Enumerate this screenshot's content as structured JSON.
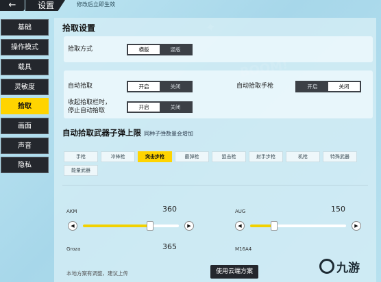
{
  "header": {
    "back_icon": "←",
    "title": "设置",
    "hint": "修改后立即生效"
  },
  "sidebar": {
    "items": [
      {
        "label": "基础"
      },
      {
        "label": "操作模式"
      },
      {
        "label": "载具"
      },
      {
        "label": "灵敏度"
      },
      {
        "label": "拾取",
        "active": true
      },
      {
        "label": "画面"
      },
      {
        "label": "声音"
      },
      {
        "label": "隐私"
      }
    ]
  },
  "pickup": {
    "section_title": "拾取设置",
    "mode": {
      "label": "拾取方式",
      "options": [
        "横版",
        "竖版"
      ],
      "selected": "横版"
    },
    "auto": {
      "label": "自动拾取",
      "options": [
        "开启",
        "关闭"
      ],
      "selected": "开启"
    },
    "auto_pistol": {
      "label": "自动拾取手枪",
      "options": [
        "开启",
        "关闭"
      ],
      "selected": "关闭"
    },
    "collapse": {
      "label_line1": "收起拾取栏时，",
      "label_line2": "停止自动拾取",
      "options": [
        "开启",
        "关闭"
      ],
      "selected": "开启"
    }
  },
  "limits": {
    "section_title": "自动拾取武器子弹上限",
    "sub": "同种子弹数量会增加",
    "tabs": [
      "手枪",
      "冲锋枪",
      "突击步枪",
      "霰弹枪",
      "狙击枪",
      "射手步枪",
      "机枪",
      "特殊武器",
      "能量武器"
    ],
    "active_tab": "突击步枪",
    "weapons": [
      {
        "name": "AKM",
        "value": "360",
        "fill": 0.7
      },
      {
        "name": "AUG",
        "value": "150",
        "fill": 0.25
      },
      {
        "name": "Groza",
        "value": "365"
      },
      {
        "name": "M16A4",
        "value": ""
      }
    ]
  },
  "footer": {
    "note": "本地方案有调整，建议上传",
    "cloud_button": "使用云端方案"
  },
  "logo": {
    "text": "九游"
  },
  "colors": {
    "accent": "#ffd400",
    "dark": "#24272d"
  }
}
